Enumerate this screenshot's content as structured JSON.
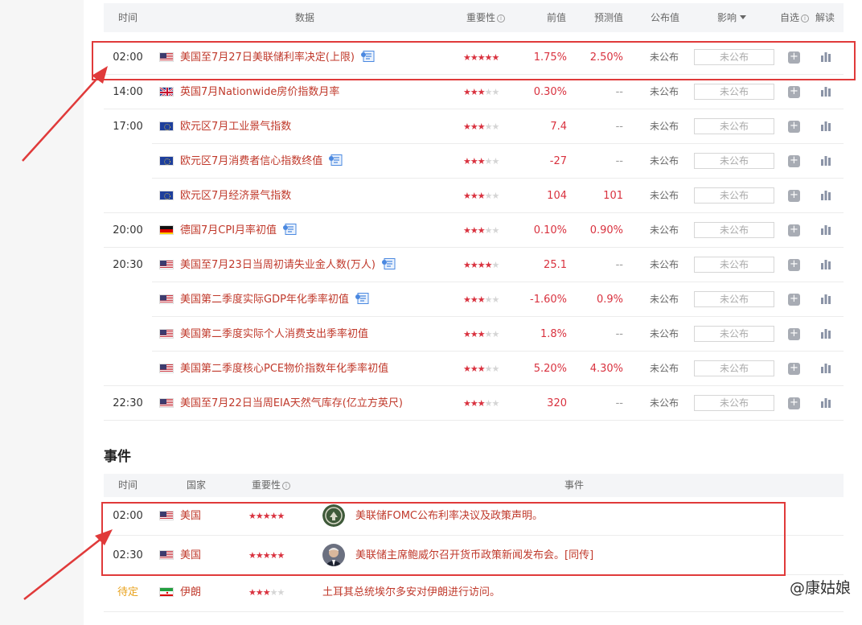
{
  "table": {
    "headers": {
      "time": "时间",
      "data": "数据",
      "importance": "重要性",
      "prev": "前值",
      "forecast": "预测值",
      "published": "公布值",
      "impact": "影响",
      "watch": "自选",
      "interpret": "解读"
    },
    "rows": [
      {
        "time": "02:00",
        "flag": "us",
        "name": "美国至7月27日美联储利率决定(上限)",
        "doc": true,
        "stars": 5,
        "prev": "1.75%",
        "forecast": "2.50%",
        "published": "未公布",
        "impact": "未公布"
      },
      {
        "time": "14:00",
        "flag": "uk",
        "name": "英国7月Nationwide房价指数月率",
        "doc": false,
        "stars": 3,
        "prev": "0.30%",
        "forecast": "--",
        "published": "未公布",
        "impact": "未公布"
      },
      {
        "time": "17:00",
        "flag": "eu",
        "name": "欧元区7月工业景气指数",
        "doc": false,
        "stars": 3,
        "prev": "7.4",
        "forecast": "--",
        "published": "未公布",
        "impact": "未公布"
      },
      {
        "time": "",
        "flag": "eu",
        "name": "欧元区7月消费者信心指数终值",
        "doc": true,
        "stars": 3,
        "prev": "-27",
        "forecast": "--",
        "published": "未公布",
        "impact": "未公布"
      },
      {
        "time": "",
        "flag": "eu",
        "name": "欧元区7月经济景气指数",
        "doc": false,
        "stars": 3,
        "prev": "104",
        "forecast": "101",
        "published": "未公布",
        "impact": "未公布"
      },
      {
        "time": "20:00",
        "flag": "de",
        "name": "德国7月CPI月率初值",
        "doc": true,
        "stars": 3,
        "prev": "0.10%",
        "forecast": "0.90%",
        "published": "未公布",
        "impact": "未公布"
      },
      {
        "time": "20:30",
        "flag": "us",
        "name": "美国至7月23日当周初请失业金人数(万人)",
        "doc": true,
        "stars": 4,
        "prev": "25.1",
        "forecast": "--",
        "published": "未公布",
        "impact": "未公布"
      },
      {
        "time": "",
        "flag": "us",
        "name": "美国第二季度实际GDP年化季率初值",
        "doc": true,
        "stars": 3,
        "prev": "-1.60%",
        "forecast": "0.9%",
        "published": "未公布",
        "impact": "未公布"
      },
      {
        "time": "",
        "flag": "us",
        "name": "美国第二季度实际个人消费支出季率初值",
        "doc": false,
        "stars": 3,
        "prev": "1.8%",
        "forecast": "--",
        "published": "未公布",
        "impact": "未公布"
      },
      {
        "time": "",
        "flag": "us",
        "name": "美国第二季度核心PCE物价指数年化季率初值",
        "doc": false,
        "stars": 3,
        "prev": "5.20%",
        "forecast": "4.30%",
        "published": "未公布",
        "impact": "未公布"
      },
      {
        "time": "22:30",
        "flag": "us",
        "name": "美国至7月22日当周EIA天然气库存(亿立方英尺)",
        "doc": false,
        "stars": 3,
        "prev": "320",
        "forecast": "--",
        "published": "未公布",
        "impact": "未公布"
      }
    ]
  },
  "events": {
    "title": "事件",
    "headers": {
      "time": "时间",
      "country": "国家",
      "importance": "重要性",
      "event": "事件"
    },
    "rows": [
      {
        "time": "02:00",
        "flag": "us",
        "country": "美国",
        "stars": 5,
        "avatar": "fed-seal",
        "event": "美联储FOMC公布利率决议及政策声明。"
      },
      {
        "time": "02:30",
        "flag": "us",
        "country": "美国",
        "stars": 5,
        "avatar": "powell",
        "event": "美联储主席鲍威尔召开货币政策新闻发布会。[同传]"
      },
      {
        "time": "待定",
        "flag": "ir",
        "country": "伊朗",
        "stars": 3,
        "avatar": "",
        "event": "土耳其总统埃尔多安对伊朗进行访问。"
      }
    ]
  },
  "watermark": "@康姑娘",
  "colors": {
    "accent_red": "#d9323f",
    "highlight": "#e03a3a",
    "pending": "#e8a21c"
  }
}
